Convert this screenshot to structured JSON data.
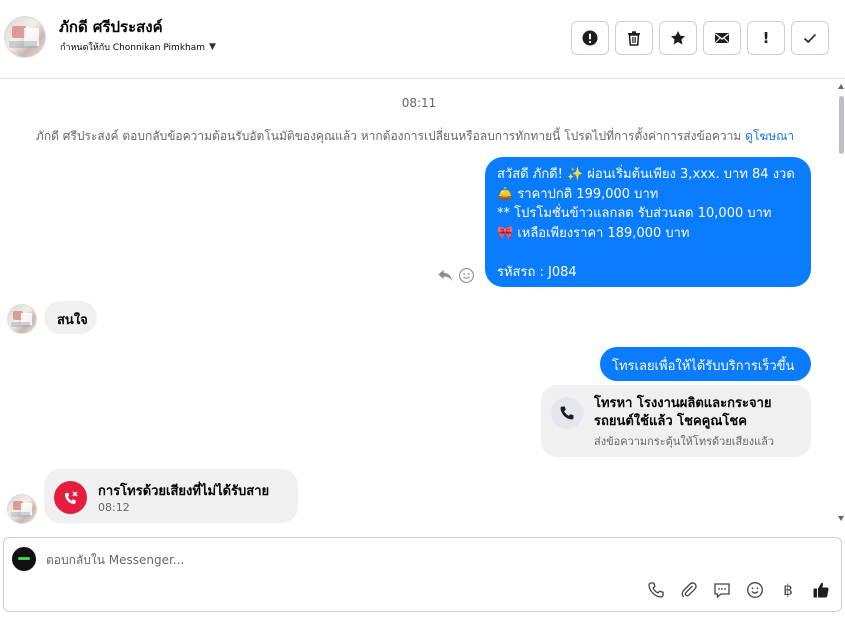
{
  "header": {
    "contact_name": "ภักดี ศรีประสงค์",
    "assigned_label": "กำหนดให้กับ Chonnikan Pimkham",
    "toolbar": {
      "icons": [
        "alert-circle-icon",
        "trash-icon",
        "star-icon",
        "envelope-icon",
        "exclamation-icon",
        "check-icon"
      ],
      "exclamation_text": "!"
    }
  },
  "conversation": {
    "timestamp": "08:11",
    "system_note": "ภักดี ศรีประสงค์ ตอบกลับข้อความต้อนรับอัตโนมัติของคุณแล้ว หากต้องการเปลี่ยนหรือลบการทักทายนี้ โปรดไปที่การตั้งค่าการส่งข้อความ",
    "system_note_link": "ดูโฆษณา",
    "outgoing_promo": {
      "lines": [
        "สวัสดี ภักดี! ✨  ผ่อนเริ่มต้นเพียง 3,xxx. บาท 84 งวด",
        "🛎️ ราคาปกติ 199,000 บาท",
        "** โปรโมชั่นข้าวแลกลด รับส่วนลด 10,000 บาท",
        "🎀  เหลือเพียงราคา 189,000 บาท",
        "",
        " รหัสรถ : J084"
      ]
    },
    "incoming_interest": "สนใจ",
    "outgoing_call_prompt": "โทรเลยเพื่อให้ได้รับบริการเร็วขึ้น",
    "call_card": {
      "title": "โทรหา โรงงานผลิตและกระจายรถยนต์ใช้แล้ว โชคคูณโชค",
      "subtitle": "ส่งข้อความกระตุ้นให้โทรด้วยเสียงแล้ว"
    },
    "missed_call": {
      "title": "การโทรด้วยเสียงที่ไม่ได้รับสาย",
      "time": "08:12"
    }
  },
  "composer": {
    "placeholder": "ตอบกลับใน Messenger...",
    "value": "",
    "tools": [
      "phone-icon",
      "paperclip-icon",
      "chat-bubble-icon",
      "emoji-icon",
      "baht-icon",
      "thumbs-up-icon"
    ],
    "baht_symbol": "฿"
  },
  "colors": {
    "outgoing_bubble": "#0a7cff",
    "incoming_bubble": "#f0f0f0",
    "missed_call_red": "#e41e3f",
    "link_blue": "#1b74e4"
  }
}
